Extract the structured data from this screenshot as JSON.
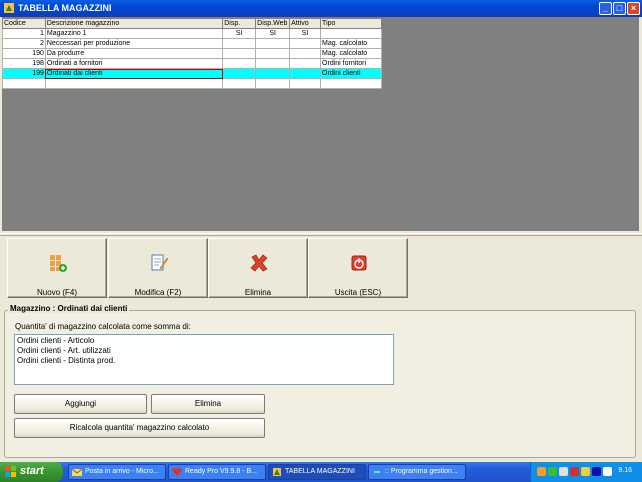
{
  "window": {
    "title": "TABELLA MAGAZZINI"
  },
  "grid": {
    "headers": [
      "Codice",
      "Descrizione magazzino",
      "Disp.",
      "Disp.Web",
      "Attivo",
      "Tipo"
    ],
    "rows": [
      [
        "1",
        "Magazzino 1",
        "SI",
        "SI",
        "SI",
        ""
      ],
      [
        "2",
        "Neccessari per produzione",
        "",
        "",
        "",
        "Mag. calcolato"
      ],
      [
        "190",
        "Da produrre",
        "",
        "",
        "",
        "Mag. calcolato"
      ],
      [
        "198",
        "Ordinati a fornitori",
        "",
        "",
        "",
        "Ordini fornitori"
      ],
      [
        "199",
        "Ordinati dai clienti",
        "",
        "",
        "",
        "Ordini clienti"
      ]
    ]
  },
  "toolbar": {
    "new_label": "Nuovo (F4)",
    "edit_label": "Modifica (F2)",
    "delete_label": "Elimina",
    "exit_label": "Uscita (ESC)"
  },
  "detail": {
    "title": "Magazzino : Ordinati dai clienti",
    "subtitle": "Quantita' di magazzino calcolata come somma di:",
    "items": [
      "Ordini clienti - Articolo",
      "Ordini clienti - Art. utilizzati",
      "Ordini clienti - Distinta prod."
    ],
    "add_label": "Aggiungi",
    "remove_label": "Elimina",
    "recalc_label": "Ricalcola quantita' magazzino calcolato"
  },
  "taskbar": {
    "start_label": "start",
    "tasks": [
      "Posta in arrivo - Micro...",
      "Ready Pro V9.9.8 - B...",
      "TABELLA MAGAZZINI",
      ":: Programma gestion..."
    ],
    "clock": "9.16"
  },
  "colors": {
    "selection": "#00FFFF",
    "titlebar": "#0046D5",
    "start": "#37962F"
  }
}
